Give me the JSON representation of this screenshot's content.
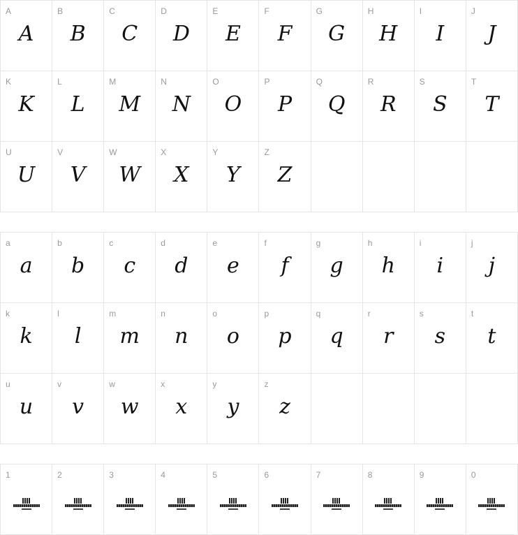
{
  "uppercase": [
    "A",
    "B",
    "C",
    "D",
    "E",
    "F",
    "G",
    "H",
    "I",
    "J",
    "K",
    "L",
    "M",
    "N",
    "O",
    "P",
    "Q",
    "R",
    "S",
    "T",
    "U",
    "V",
    "W",
    "X",
    "Y",
    "Z"
  ],
  "lowercase": [
    "a",
    "b",
    "c",
    "d",
    "e",
    "f",
    "g",
    "h",
    "i",
    "j",
    "k",
    "l",
    "m",
    "n",
    "o",
    "p",
    "q",
    "r",
    "s",
    "t",
    "u",
    "v",
    "w",
    "x",
    "y",
    "z"
  ],
  "digits": [
    "1",
    "2",
    "3",
    "4",
    "5",
    "6",
    "7",
    "8",
    "9",
    "0"
  ],
  "digit_glyph_icon": "font-logo-placeholder-icon"
}
